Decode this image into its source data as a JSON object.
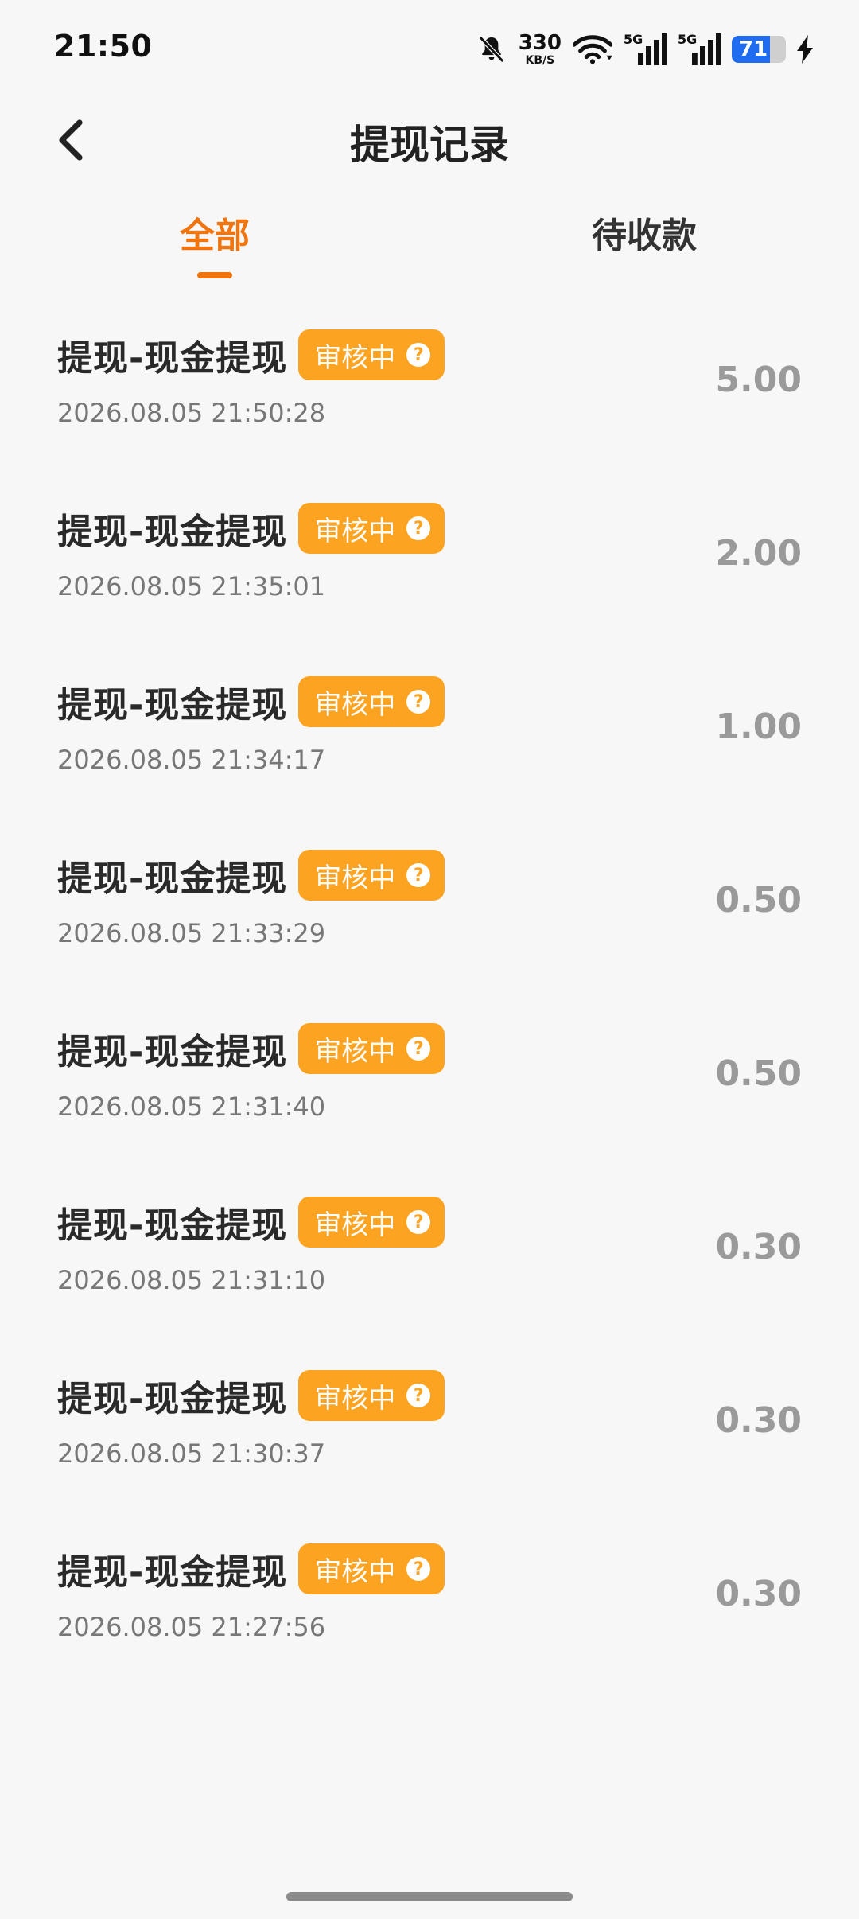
{
  "status_bar": {
    "time": "21:50",
    "net_speed": "330",
    "net_unit": "KB/S",
    "sim1": "5G",
    "sim2": "5G",
    "battery_level": "71",
    "battery_fraction": 0.71
  },
  "header": {
    "title": "提现记录"
  },
  "tabs": {
    "all": "全部",
    "pending": "待收款",
    "active": "all"
  },
  "records": [
    {
      "title": "提现-现金提现",
      "status": "审核中",
      "time": "2026.08.05 21:50:28",
      "amount": "5.00"
    },
    {
      "title": "提现-现金提现",
      "status": "审核中",
      "time": "2026.08.05 21:35:01",
      "amount": "2.00"
    },
    {
      "title": "提现-现金提现",
      "status": "审核中",
      "time": "2026.08.05 21:34:17",
      "amount": "1.00"
    },
    {
      "title": "提现-现金提现",
      "status": "审核中",
      "time": "2026.08.05 21:33:29",
      "amount": "0.50"
    },
    {
      "title": "提现-现金提现",
      "status": "审核中",
      "time": "2026.08.05 21:31:40",
      "amount": "0.50"
    },
    {
      "title": "提现-现金提现",
      "status": "审核中",
      "time": "2026.08.05 21:31:10",
      "amount": "0.30"
    },
    {
      "title": "提现-现金提现",
      "status": "审核中",
      "time": "2026.08.05 21:30:37",
      "amount": "0.30"
    },
    {
      "title": "提现-现金提现",
      "status": "审核中",
      "time": "2026.08.05 21:27:56",
      "amount": "0.30"
    }
  ],
  "help_icon_glyph": "?",
  "colors": {
    "accent": "#f0750f",
    "badge": "#fca422",
    "amount": "#9a9a9a",
    "battery": "#1f6cf0"
  }
}
